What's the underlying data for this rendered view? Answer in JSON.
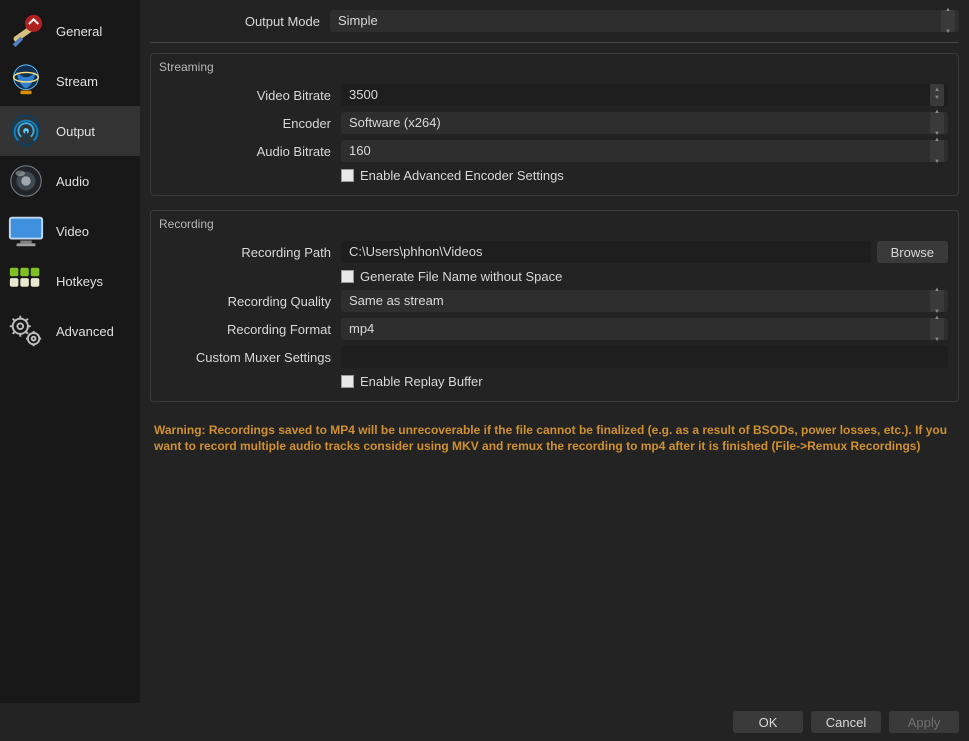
{
  "sidebar": {
    "items": [
      {
        "label": "General",
        "icon": "general-icon"
      },
      {
        "label": "Stream",
        "icon": "stream-icon"
      },
      {
        "label": "Output",
        "icon": "output-icon",
        "selected": true
      },
      {
        "label": "Audio",
        "icon": "audio-icon"
      },
      {
        "label": "Video",
        "icon": "video-icon"
      },
      {
        "label": "Hotkeys",
        "icon": "hotkeys-icon"
      },
      {
        "label": "Advanced",
        "icon": "advanced-icon"
      }
    ]
  },
  "output": {
    "output_mode_label": "Output Mode",
    "output_mode_value": "Simple",
    "streaming": {
      "title": "Streaming",
      "video_bitrate_label": "Video Bitrate",
      "video_bitrate_value": "3500",
      "encoder_label": "Encoder",
      "encoder_value": "Software (x264)",
      "audio_bitrate_label": "Audio Bitrate",
      "audio_bitrate_value": "160",
      "enable_advanced_label": "Enable Advanced Encoder Settings"
    },
    "recording": {
      "title": "Recording",
      "path_label": "Recording Path",
      "path_value": "C:\\Users\\phhon\\Videos",
      "browse_label": "Browse",
      "gen_filename_label": "Generate File Name without Space",
      "quality_label": "Recording Quality",
      "quality_value": "Same as stream",
      "format_label": "Recording Format",
      "format_value": "mp4",
      "muxer_label": "Custom Muxer Settings",
      "muxer_value": "",
      "replay_buffer_label": "Enable Replay Buffer"
    },
    "warning_text": "Warning: Recordings saved to MP4 will be unrecoverable if the file cannot be finalized (e.g. as a result of BSODs, power losses, etc.). If you want to record multiple audio tracks consider using MKV and remux the recording to mp4 after it is finished (File->Remux Recordings)"
  },
  "buttons": {
    "ok": "OK",
    "cancel": "Cancel",
    "apply": "Apply"
  }
}
